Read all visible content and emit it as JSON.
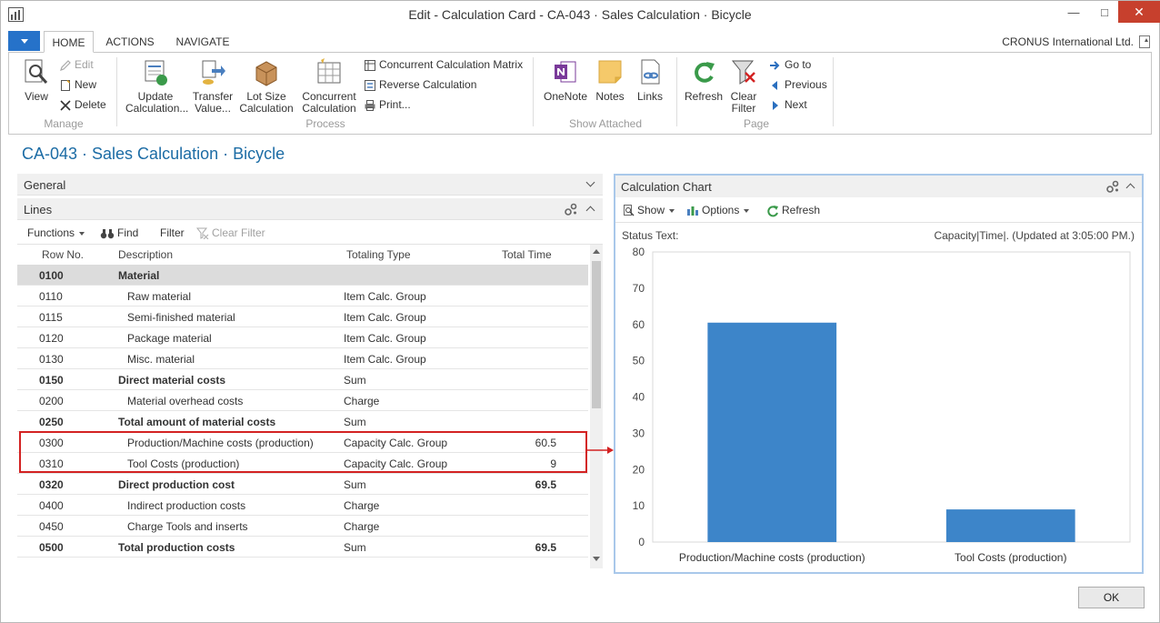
{
  "window": {
    "title": "Edit - Calculation Card - CA-043 · Sales Calculation · Bicycle",
    "minimize": "—",
    "maximize": "□",
    "close": "✕"
  },
  "ribbon_tabs": [
    "HOME",
    "ACTIONS",
    "NAVIGATE"
  ],
  "company": "CRONUS International Ltd.",
  "ribbon": {
    "manage": {
      "label": "Manage",
      "view": "View",
      "edit": "Edit",
      "new": "New",
      "delete": "Delete"
    },
    "process": {
      "label": "Process",
      "update_calculation_1": "Update",
      "update_calculation_2": "Calculation...",
      "transfer_value_1": "Transfer",
      "transfer_value_2": "Value...",
      "lot_size_1": "Lot Size",
      "lot_size_2": "Calculation",
      "concurrent_calc_1": "Concurrent",
      "concurrent_calc_2": "Calculation",
      "concurrent_matrix": "Concurrent Calculation Matrix",
      "reverse_calc": "Reverse Calculation",
      "print": "Print..."
    },
    "show_attached": {
      "label": "Show Attached",
      "onenote": "OneNote",
      "notes": "Notes",
      "links": "Links"
    },
    "page": {
      "label": "Page",
      "refresh": "Refresh",
      "clear_filter_1": "Clear",
      "clear_filter_2": "Filter",
      "go_to": "Go to",
      "previous": "Previous",
      "next": "Next"
    }
  },
  "page_title": "CA-043 · Sales Calculation · Bicycle",
  "general_tab": "General",
  "lines": {
    "title": "Lines",
    "toolbar": {
      "functions": "Functions",
      "find": "Find",
      "filter": "Filter",
      "clear_filter": "Clear Filter"
    },
    "columns": [
      "Row No.",
      "Description",
      "Totaling Type",
      "Total Time"
    ],
    "rows": [
      {
        "row": "0100",
        "desc": "Material",
        "type": "",
        "time": "",
        "bold": true,
        "indent": false,
        "selected": true
      },
      {
        "row": "0110",
        "desc": "Raw material",
        "type": "Item Calc. Group",
        "time": "",
        "bold": false,
        "indent": true,
        "selected": false
      },
      {
        "row": "0115",
        "desc": "Semi-finished material",
        "type": "Item Calc. Group",
        "time": "",
        "bold": false,
        "indent": true,
        "selected": false
      },
      {
        "row": "0120",
        "desc": "Package material",
        "type": "Item Calc. Group",
        "time": "",
        "bold": false,
        "indent": true,
        "selected": false
      },
      {
        "row": "0130",
        "desc": "Misc. material",
        "type": "Item Calc. Group",
        "time": "",
        "bold": false,
        "indent": true,
        "selected": false
      },
      {
        "row": "0150",
        "desc": "Direct material costs",
        "type": "Sum",
        "time": "",
        "bold": true,
        "indent": false,
        "selected": false
      },
      {
        "row": "0200",
        "desc": "Material overhead costs",
        "type": "Charge",
        "time": "",
        "bold": false,
        "indent": true,
        "selected": false
      },
      {
        "row": "0250",
        "desc": "Total amount of material costs",
        "type": "Sum",
        "time": "",
        "bold": true,
        "indent": false,
        "selected": false
      },
      {
        "row": "0300",
        "desc": "Production/Machine costs (production)",
        "type": "Capacity Calc. Group",
        "time": "60.5",
        "bold": false,
        "indent": true,
        "selected": false
      },
      {
        "row": "0310",
        "desc": "Tool Costs (production)",
        "type": "Capacity Calc. Group",
        "time": "9",
        "bold": false,
        "indent": true,
        "selected": false
      },
      {
        "row": "0320",
        "desc": "Direct production cost",
        "type": "Sum",
        "time": "69.5",
        "bold": true,
        "indent": false,
        "selected": false
      },
      {
        "row": "0400",
        "desc": "Indirect production costs",
        "type": "Charge",
        "time": "",
        "bold": false,
        "indent": true,
        "selected": false
      },
      {
        "row": "0450",
        "desc": "Charge Tools and inserts",
        "type": "Charge",
        "time": "",
        "bold": false,
        "indent": true,
        "selected": false
      },
      {
        "row": "0500",
        "desc": "Total production costs",
        "type": "Sum",
        "time": "69.5",
        "bold": true,
        "indent": false,
        "selected": false
      }
    ]
  },
  "chart_part": {
    "title": "Calculation Chart",
    "show": "Show",
    "options": "Options",
    "refresh": "Refresh",
    "status_label": "Status Text:",
    "status_value": "Capacity|Time|. (Updated at  3:05:00 PM.)"
  },
  "ok_button": "OK",
  "colors": {
    "bar": "#3d85c9",
    "highlight": "#d32222",
    "title_blue": "#1c6ca5"
  },
  "chart_data": {
    "type": "bar",
    "categories": [
      "Production/Machine costs (production)",
      "Tool Costs (production)"
    ],
    "values": [
      60.5,
      9
    ],
    "title": "",
    "xlabel": "",
    "ylabel": "",
    "ylim": [
      0,
      80
    ],
    "yticks": [
      0,
      10,
      20,
      30,
      40,
      50,
      60,
      70,
      80
    ],
    "grid": false,
    "legend": "none"
  }
}
